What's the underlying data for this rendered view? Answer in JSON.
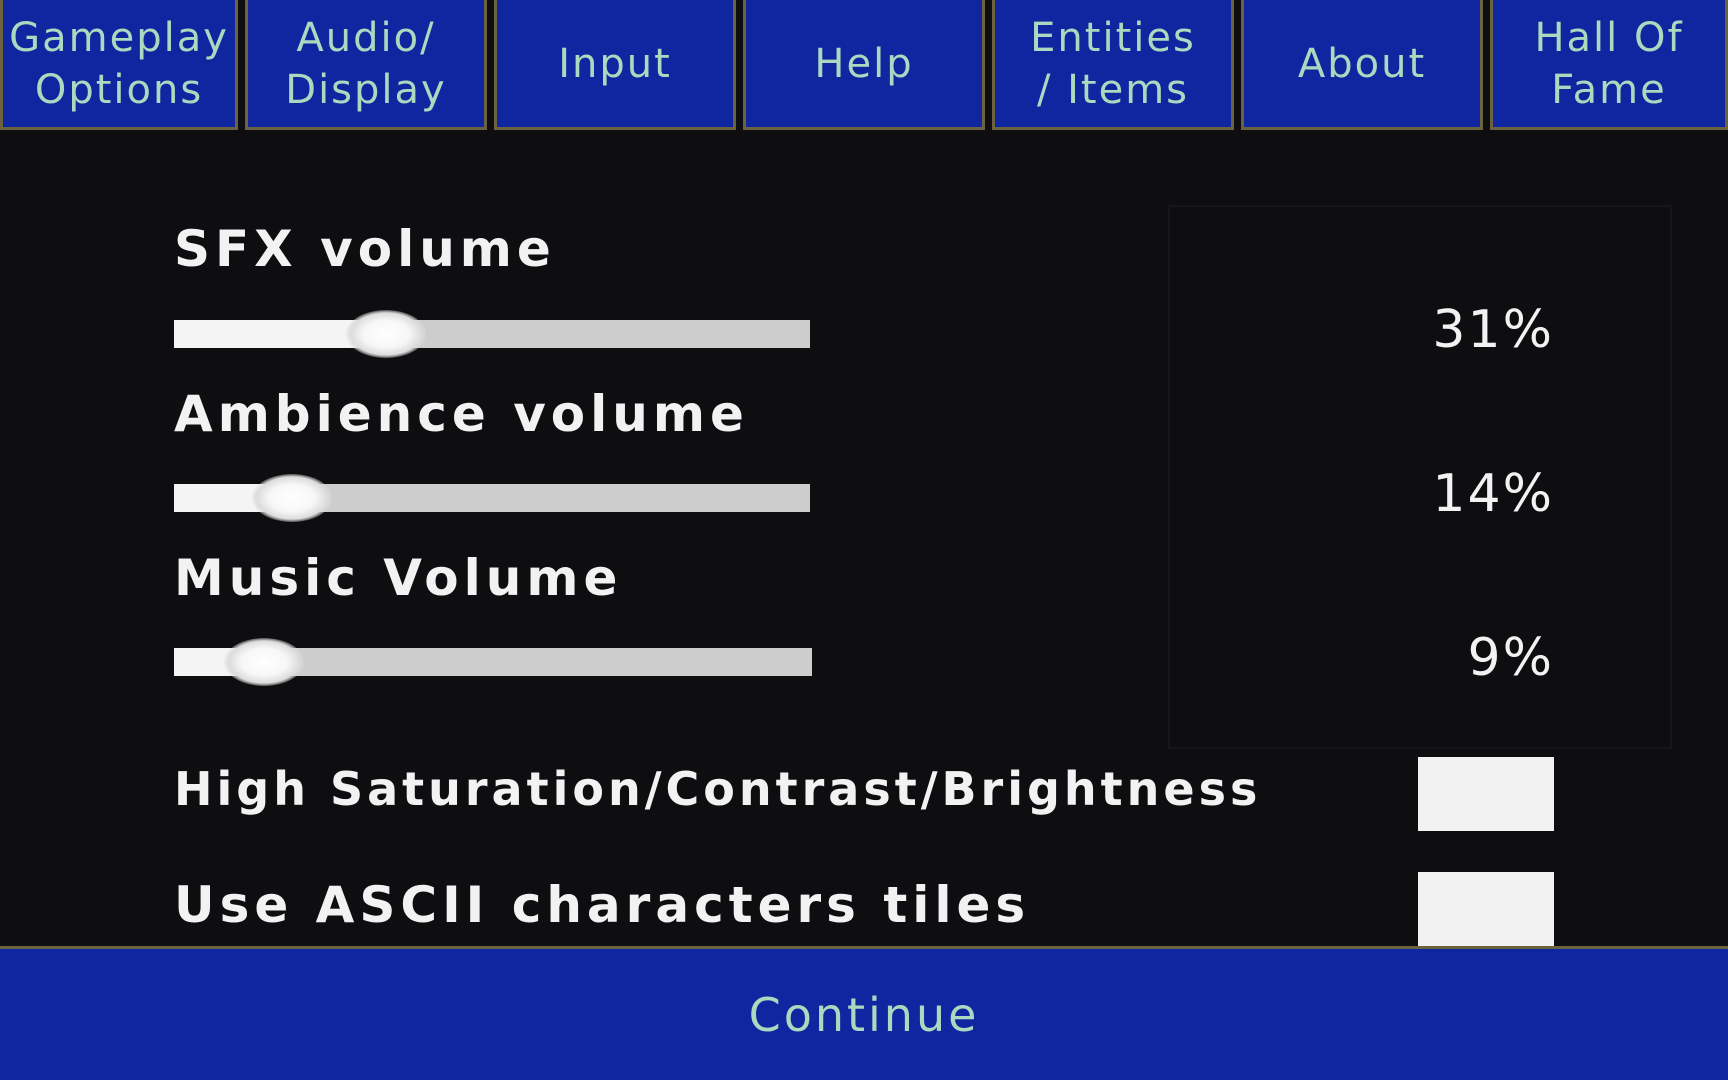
{
  "colors": {
    "tab_bg": "#0f26a0",
    "tab_text": "#a9d9bf",
    "tab_border": "#6b6240",
    "panel_bg": "#0e0e11",
    "label_text": "#f2f2f2",
    "slider_track": "#cdcdcd",
    "slider_fill": "#f4f4f4"
  },
  "tabs": [
    {
      "label": "Gameplay\nOptions"
    },
    {
      "label": "Audio/\nDisplay"
    },
    {
      "label": "Input"
    },
    {
      "label": "Help"
    },
    {
      "label": "Entities\n/ Items"
    },
    {
      "label": "About"
    },
    {
      "label": "Hall Of\nFame"
    }
  ],
  "settings": {
    "sfx": {
      "label": "SFX volume",
      "value": 31,
      "value_text": "31%"
    },
    "ambience": {
      "label": "Ambience volume",
      "value": 14,
      "value_text": "14%"
    },
    "music": {
      "label": "Music Volume",
      "value": 9,
      "value_text": "9%"
    },
    "high_saturation": {
      "label": "High Saturation/Contrast/Brightness",
      "checked": false
    },
    "ascii_tiles": {
      "label": "Use ASCII characters tiles",
      "checked": false
    }
  },
  "continue": {
    "label": "Continue"
  }
}
